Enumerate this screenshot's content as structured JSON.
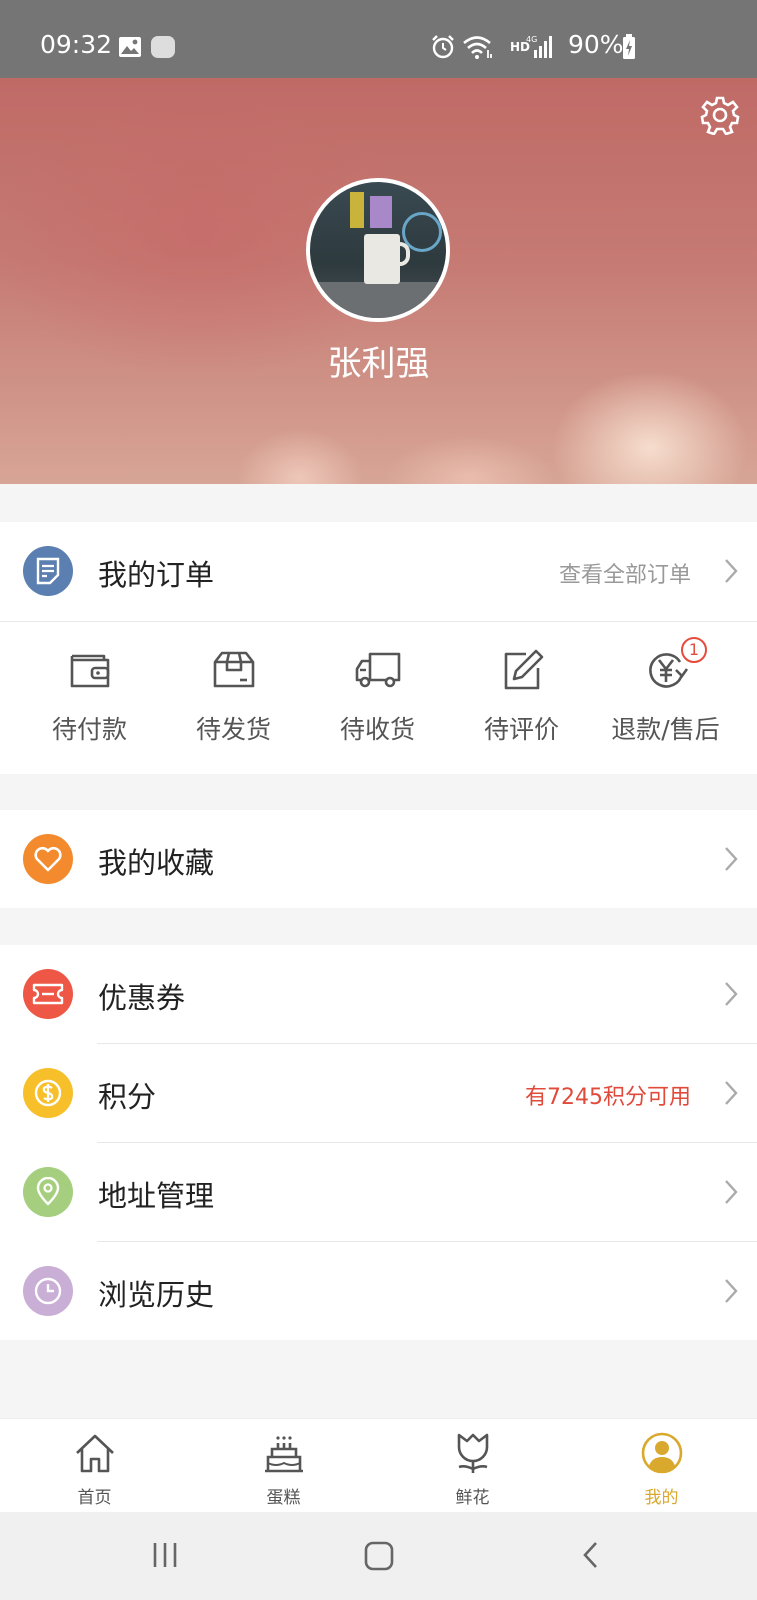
{
  "status_bar": {
    "time": "09:32",
    "network": "HD",
    "battery": "90%",
    "icons": [
      "image-icon",
      "dex-icon",
      "alarm-icon",
      "wifi-icon",
      "signal-icon",
      "battery-icon"
    ],
    "dex_label": "DeX"
  },
  "header": {
    "username": "张利强",
    "settings_icon": "gear-icon"
  },
  "orders": {
    "title": "我的订单",
    "view_all": "查看全部订单",
    "items": [
      {
        "label": "待付款",
        "icon": "wallet-icon"
      },
      {
        "label": "待发货",
        "icon": "package-icon"
      },
      {
        "label": "待收货",
        "icon": "truck-icon"
      },
      {
        "label": "待评价",
        "icon": "edit-icon"
      },
      {
        "label": "退款/售后",
        "icon": "refund-icon",
        "badge": "1"
      }
    ],
    "accent": "#5b7fb0"
  },
  "favorites": {
    "title": "我的收藏",
    "accent": "#f38a2e"
  },
  "menu": [
    {
      "title": "优惠券",
      "icon": "coupon-icon",
      "accent": "#ee5745",
      "right": ""
    },
    {
      "title": "积分",
      "icon": "coin-icon",
      "accent": "#f7c02b",
      "right": "有7245积分可用"
    },
    {
      "title": "地址管理",
      "icon": "location-icon",
      "accent": "#a5cf7e",
      "right": ""
    },
    {
      "title": "浏览历史",
      "icon": "clock-icon",
      "accent": "#c9aed6",
      "right": ""
    }
  ],
  "bottom_nav": [
    {
      "label": "首页",
      "icon": "home-icon",
      "active": false
    },
    {
      "label": "蛋糕",
      "icon": "cake-icon",
      "active": false
    },
    {
      "label": "鲜花",
      "icon": "flower-icon",
      "active": false
    },
    {
      "label": "我的",
      "icon": "profile-icon",
      "active": true
    }
  ],
  "active_color": "#d9a92d",
  "system_nav": [
    "recent-apps-icon",
    "home-button-icon",
    "back-icon"
  ]
}
